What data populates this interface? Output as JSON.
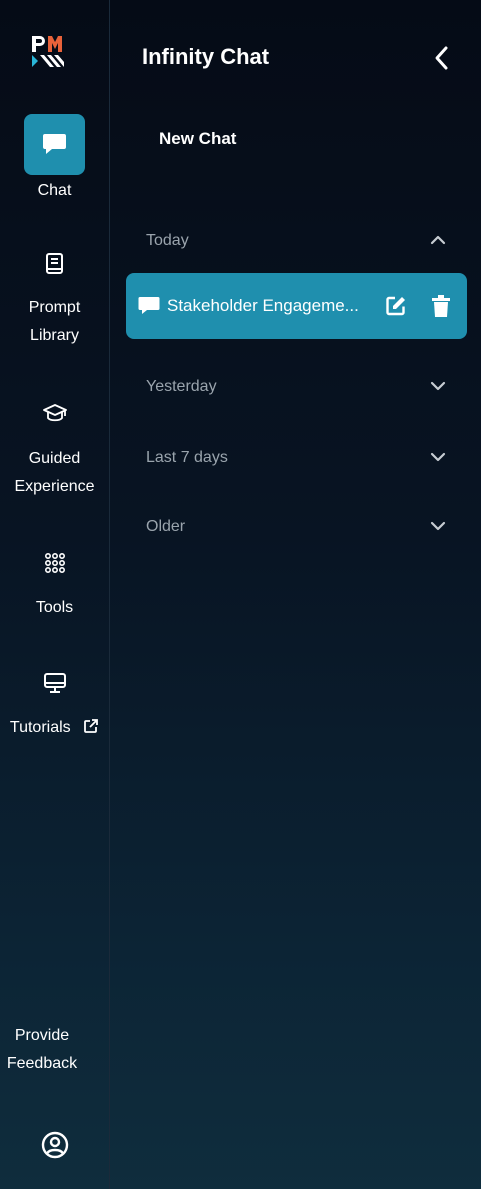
{
  "sidebar": {
    "logo_text": "PMI",
    "items": [
      {
        "label": "Chat",
        "icon": "chat-bubble-icon"
      },
      {
        "label": "Prompt Library",
        "icon": "book-icon"
      },
      {
        "label": "Guided Experience",
        "icon": "graduation-cap-icon"
      },
      {
        "label": "Tools",
        "icon": "grid-dots-icon"
      },
      {
        "label": "Tutorials",
        "icon": "monitor-icon"
      }
    ],
    "feedback_label": "Provide Feedback",
    "profile_icon": "user-circle-icon"
  },
  "panel": {
    "title": "Infinity Chat",
    "new_chat_label": "New Chat",
    "sections": [
      {
        "label": "Today",
        "expanded": true
      },
      {
        "label": "Yesterday",
        "expanded": false
      },
      {
        "label": "Last 7 days",
        "expanded": false
      },
      {
        "label": "Older",
        "expanded": false
      }
    ],
    "today_chats": [
      {
        "title": "Stakeholder Engageme..."
      }
    ]
  },
  "colors": {
    "accent": "#1f8fae",
    "background": "#081423",
    "muted_text": "#9aa4ad"
  }
}
